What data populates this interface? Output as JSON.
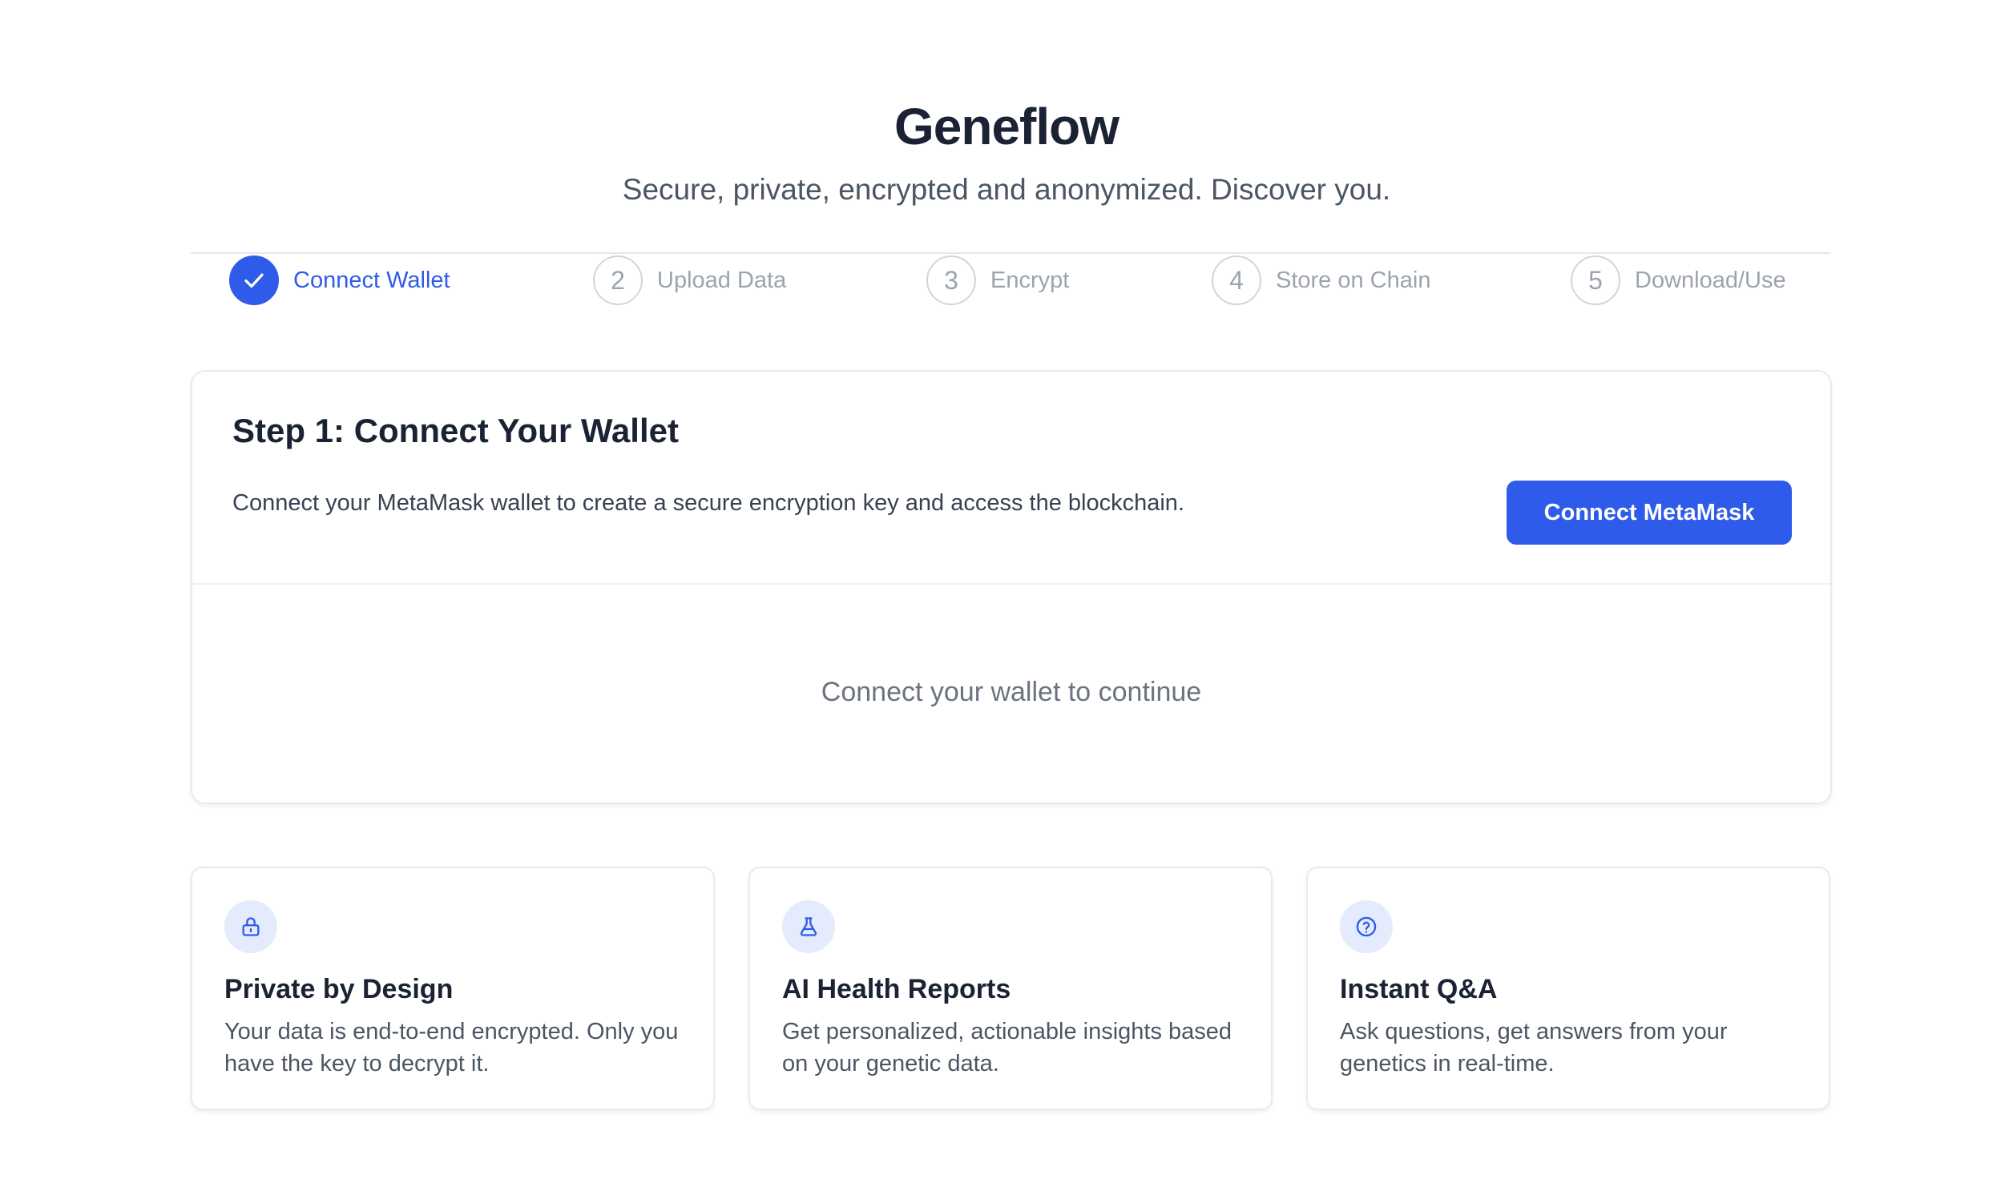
{
  "header": {
    "title": "Geneflow",
    "subtitle": "Secure, private, encrypted and anonymized. Discover you."
  },
  "stepper": {
    "steps": [
      {
        "number": "1",
        "label": "Connect Wallet",
        "state": "completed",
        "icon": "check-icon"
      },
      {
        "number": "2",
        "label": "Upload Data",
        "state": "pending"
      },
      {
        "number": "3",
        "label": "Encrypt",
        "state": "pending"
      },
      {
        "number": "4",
        "label": "Store on Chain",
        "state": "pending"
      },
      {
        "number": "5",
        "label": "Download/Use",
        "state": "pending"
      }
    ]
  },
  "main_card": {
    "heading": "Step 1: Connect Your Wallet",
    "description": "Connect your MetaMask wallet to create a secure encryption key and access the blockchain.",
    "button_label": "Connect MetaMask",
    "empty_state": "Connect your wallet to continue"
  },
  "features": [
    {
      "icon": "lock-icon",
      "title": "Private by Design",
      "description": "Your data is end-to-end encrypted. Only you have the key to decrypt it."
    },
    {
      "icon": "flask-icon",
      "title": "AI Health Reports",
      "description": "Get personalized, actionable insights based on your genetic data."
    },
    {
      "icon": "help-circle-icon",
      "title": "Instant Q&A",
      "description": "Ask questions, get answers from your genetics in real-time."
    }
  ],
  "colors": {
    "accent": "#2f5bea",
    "icon_background": "#e3ebfc",
    "muted_text": "#9ca3af",
    "heading_text": "#1a2233"
  }
}
